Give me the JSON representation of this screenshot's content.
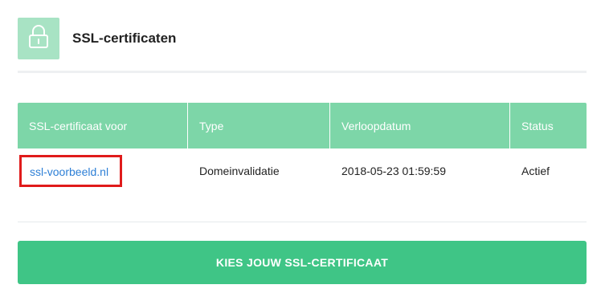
{
  "header": {
    "title": "SSL-certificaten",
    "icon": "lock-icon",
    "icon_bg_color": "#a8e3c4"
  },
  "table": {
    "columns": [
      "SSL-certificaat voor",
      "Type",
      "Verloopdatum",
      "Status"
    ],
    "rows": [
      {
        "domain": "ssl-voorbeeld.nl",
        "type": "Domeinvalidatie",
        "expiry": "2018-05-23 01:59:59",
        "status": "Actief"
      }
    ],
    "header_color": "#7dd6a8",
    "link_color": "#2d7fd6",
    "status_color": "#2e8b3a",
    "highlight_color": "#e01b1b"
  },
  "cta": {
    "label": "KIES JOUW SSL-CERTIFICAAT",
    "color": "#3fc586"
  }
}
